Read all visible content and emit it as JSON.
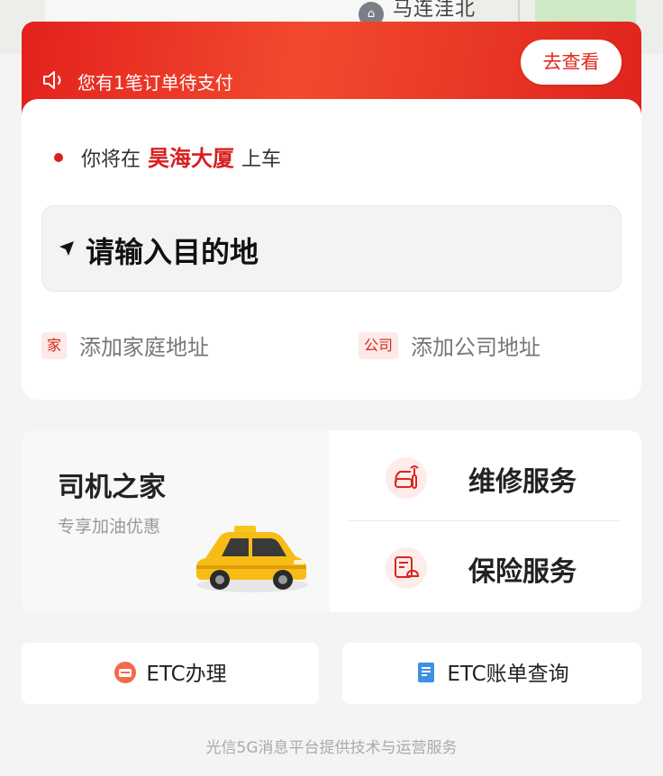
{
  "map": {
    "label": "马连洼北",
    "pin_icon": "building-pin-icon"
  },
  "notice": {
    "icon": "speaker-icon",
    "text": "您有1笔订单待支付",
    "button_label": "去查看",
    "color": "#e3211d"
  },
  "pickup": {
    "prefix": "你将在",
    "place": "昊海大厦",
    "suffix": "上车",
    "accent_color": "#d81e1e"
  },
  "destination": {
    "icon": "navigation-arrow-icon",
    "placeholder": "请输入目的地"
  },
  "quick_addresses": {
    "home": {
      "tag": "家",
      "label": "添加家庭地址"
    },
    "company": {
      "tag": "公司",
      "label": "添加公司地址"
    }
  },
  "driver_home": {
    "title": "司机之家",
    "subtitle": "专享加油优惠",
    "image": "taxi-illustration"
  },
  "services": [
    {
      "icon": "repair-wrench-icon",
      "label": "维修服务"
    },
    {
      "icon": "insurance-document-icon",
      "label": "保险服务"
    }
  ],
  "etc": {
    "apply": {
      "icon": "etc-card-icon",
      "label": "ETC办理"
    },
    "bill": {
      "icon": "bill-document-icon",
      "label": "ETC账单查询"
    }
  },
  "footer": {
    "text": "光信5G消息平台提供技术与运营服务"
  }
}
